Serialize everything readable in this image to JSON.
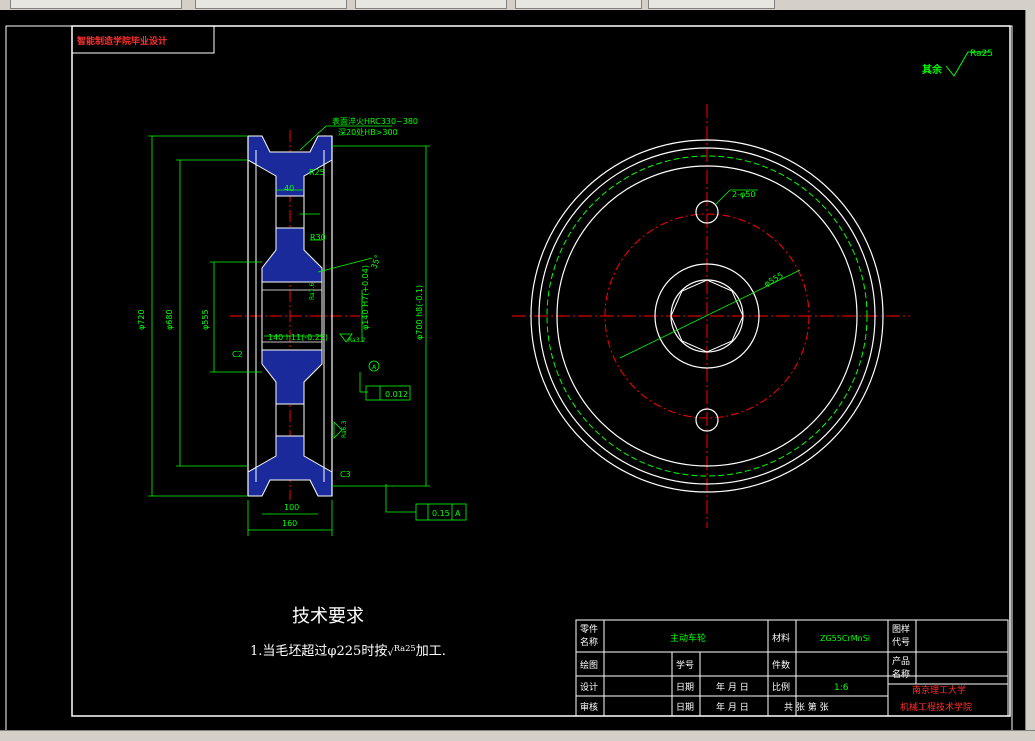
{
  "title_block": {
    "school_label": "智能制造学院毕业设计",
    "part_name_label": "零件\n名称",
    "part_name": "主动车轮",
    "material_label": "材料",
    "material": "ZG55CrMnSi",
    "drawing_code_label": "图样\n代号",
    "product_name_label": "产品\n名称",
    "row_drawn": "绘图",
    "row_design": "设计",
    "row_review": "审核",
    "student_no_label": "学号",
    "date_label": "日期",
    "date_value": "年 月 日",
    "qty_label": "件数",
    "scale_label": "比例",
    "scale_value": "1:6",
    "sheets_value": "共  张  第  张",
    "university": "南京理工大学",
    "college": "机械工程技术学院"
  },
  "tech_req": {
    "title": "技术要求",
    "item1_pre": "1.当毛坯超过φ225时按",
    "item1_rough": "Ra25",
    "item1_post": "加工."
  },
  "roughness_note": {
    "label": "其余",
    "value": "Ra25"
  },
  "dimensions": {
    "surface_treat": "表面淬火HRC330~380",
    "depth": "深20处HB>300",
    "r25": "R25",
    "d40": "40",
    "r30": "R30",
    "angle": "35°",
    "d140": "140 h11(-0.25)",
    "d140b": "φ140 H7(+0.04)",
    "phi720": "φ720",
    "phi680": "φ680",
    "phi555": "φ555",
    "phi700": "φ700 h8(-0.1)",
    "c2": "C2",
    "c3": "C3",
    "flat1": "0.012",
    "datum": "A",
    "runout": "0.15",
    "w100": "100",
    "w160": "160",
    "holes": "2-φ50",
    "phi555r": "φ555",
    "ra1": "Ra3.2",
    "ra2": "Ra6.3",
    "ra3": "Ra1.6"
  },
  "colors": {
    "background": "#000000",
    "outline": "#ffffff",
    "dimension": "#00ff00",
    "center_line": "#ff0000",
    "section_fill": "#1a2a9a",
    "title_red": "#ff3030"
  }
}
